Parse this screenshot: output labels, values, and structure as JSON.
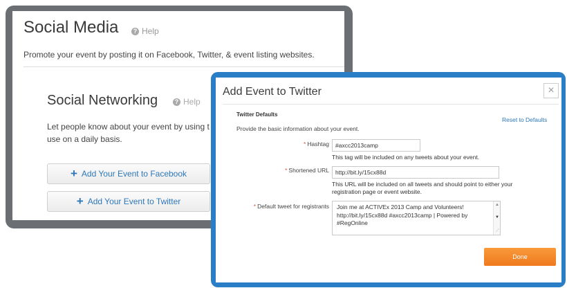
{
  "social_media": {
    "title": "Social Media",
    "help": "Help",
    "description": "Promote your event by posting it on Facebook, Twitter, & event listing websites.",
    "networking": {
      "title": "Social Networking",
      "help": "Help",
      "description": "Let people know about your event by using t that they use on a daily basis."
    },
    "buttons": {
      "facebook": "Add Your Event to Facebook",
      "twitter": "Add Your Event to Twitter"
    }
  },
  "twitter_dialog": {
    "title": "Add Event to Twitter",
    "close": "×",
    "section_title": "Twitter Defaults",
    "reset_link": "Reset to Defaults",
    "section_description": "Provide the basic information about your event.",
    "required_mark": "*",
    "fields": {
      "hashtag": {
        "label": "Hashtag",
        "value": "#axcc2013camp",
        "hint": "This tag will be included on any tweets about your event."
      },
      "shortened_url": {
        "label": "Shortened URL",
        "value": "http://bit.ly/15cx88d",
        "hint": "This URL will be included on all tweets and should point to either your registration page or event website."
      },
      "default_tweet": {
        "label": "Default tweet for registrants",
        "value": "Join me at ACTIVEx 2013 Camp and Volunteers! http://bit.ly/15cx88d #axcc2013camp | Powered by #RegOnline"
      }
    },
    "done_label": "Done"
  },
  "colors": {
    "accent_blue": "#2d77b8",
    "dialog_frame": "#2a7ec5",
    "panel_frame": "#6b6e73",
    "done_orange": "#f0791e",
    "required_red": "#d9533b"
  },
  "icons": {
    "help": "question-circle-icon",
    "add": "plus-icon",
    "close": "close-icon"
  }
}
